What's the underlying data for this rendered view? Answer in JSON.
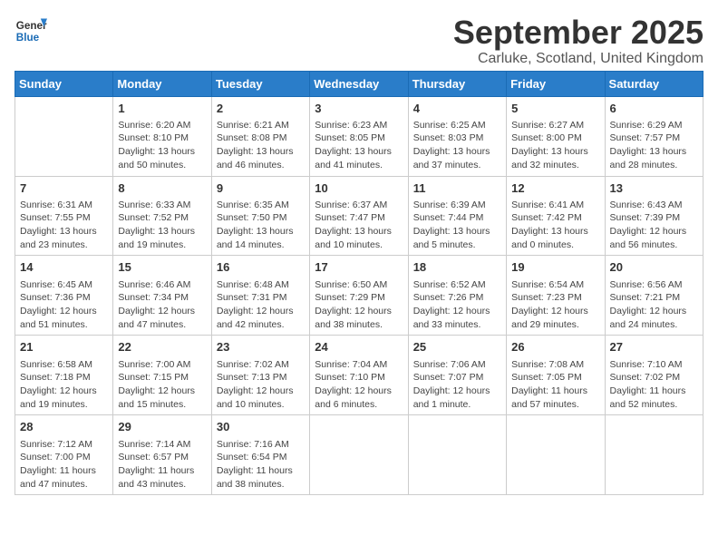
{
  "header": {
    "logo_general": "General",
    "logo_blue": "Blue",
    "month_title": "September 2025",
    "location": "Carluke, Scotland, United Kingdom"
  },
  "days_of_week": [
    "Sunday",
    "Monday",
    "Tuesday",
    "Wednesday",
    "Thursday",
    "Friday",
    "Saturday"
  ],
  "weeks": [
    [
      {
        "day": "",
        "info": ""
      },
      {
        "day": "1",
        "info": "Sunrise: 6:20 AM\nSunset: 8:10 PM\nDaylight: 13 hours\nand 50 minutes."
      },
      {
        "day": "2",
        "info": "Sunrise: 6:21 AM\nSunset: 8:08 PM\nDaylight: 13 hours\nand 46 minutes."
      },
      {
        "day": "3",
        "info": "Sunrise: 6:23 AM\nSunset: 8:05 PM\nDaylight: 13 hours\nand 41 minutes."
      },
      {
        "day": "4",
        "info": "Sunrise: 6:25 AM\nSunset: 8:03 PM\nDaylight: 13 hours\nand 37 minutes."
      },
      {
        "day": "5",
        "info": "Sunrise: 6:27 AM\nSunset: 8:00 PM\nDaylight: 13 hours\nand 32 minutes."
      },
      {
        "day": "6",
        "info": "Sunrise: 6:29 AM\nSunset: 7:57 PM\nDaylight: 13 hours\nand 28 minutes."
      }
    ],
    [
      {
        "day": "7",
        "info": "Sunrise: 6:31 AM\nSunset: 7:55 PM\nDaylight: 13 hours\nand 23 minutes."
      },
      {
        "day": "8",
        "info": "Sunrise: 6:33 AM\nSunset: 7:52 PM\nDaylight: 13 hours\nand 19 minutes."
      },
      {
        "day": "9",
        "info": "Sunrise: 6:35 AM\nSunset: 7:50 PM\nDaylight: 13 hours\nand 14 minutes."
      },
      {
        "day": "10",
        "info": "Sunrise: 6:37 AM\nSunset: 7:47 PM\nDaylight: 13 hours\nand 10 minutes."
      },
      {
        "day": "11",
        "info": "Sunrise: 6:39 AM\nSunset: 7:44 PM\nDaylight: 13 hours\nand 5 minutes."
      },
      {
        "day": "12",
        "info": "Sunrise: 6:41 AM\nSunset: 7:42 PM\nDaylight: 13 hours\nand 0 minutes."
      },
      {
        "day": "13",
        "info": "Sunrise: 6:43 AM\nSunset: 7:39 PM\nDaylight: 12 hours\nand 56 minutes."
      }
    ],
    [
      {
        "day": "14",
        "info": "Sunrise: 6:45 AM\nSunset: 7:36 PM\nDaylight: 12 hours\nand 51 minutes."
      },
      {
        "day": "15",
        "info": "Sunrise: 6:46 AM\nSunset: 7:34 PM\nDaylight: 12 hours\nand 47 minutes."
      },
      {
        "day": "16",
        "info": "Sunrise: 6:48 AM\nSunset: 7:31 PM\nDaylight: 12 hours\nand 42 minutes."
      },
      {
        "day": "17",
        "info": "Sunrise: 6:50 AM\nSunset: 7:29 PM\nDaylight: 12 hours\nand 38 minutes."
      },
      {
        "day": "18",
        "info": "Sunrise: 6:52 AM\nSunset: 7:26 PM\nDaylight: 12 hours\nand 33 minutes."
      },
      {
        "day": "19",
        "info": "Sunrise: 6:54 AM\nSunset: 7:23 PM\nDaylight: 12 hours\nand 29 minutes."
      },
      {
        "day": "20",
        "info": "Sunrise: 6:56 AM\nSunset: 7:21 PM\nDaylight: 12 hours\nand 24 minutes."
      }
    ],
    [
      {
        "day": "21",
        "info": "Sunrise: 6:58 AM\nSunset: 7:18 PM\nDaylight: 12 hours\nand 19 minutes."
      },
      {
        "day": "22",
        "info": "Sunrise: 7:00 AM\nSunset: 7:15 PM\nDaylight: 12 hours\nand 15 minutes."
      },
      {
        "day": "23",
        "info": "Sunrise: 7:02 AM\nSunset: 7:13 PM\nDaylight: 12 hours\nand 10 minutes."
      },
      {
        "day": "24",
        "info": "Sunrise: 7:04 AM\nSunset: 7:10 PM\nDaylight: 12 hours\nand 6 minutes."
      },
      {
        "day": "25",
        "info": "Sunrise: 7:06 AM\nSunset: 7:07 PM\nDaylight: 12 hours\nand 1 minute."
      },
      {
        "day": "26",
        "info": "Sunrise: 7:08 AM\nSunset: 7:05 PM\nDaylight: 11 hours\nand 57 minutes."
      },
      {
        "day": "27",
        "info": "Sunrise: 7:10 AM\nSunset: 7:02 PM\nDaylight: 11 hours\nand 52 minutes."
      }
    ],
    [
      {
        "day": "28",
        "info": "Sunrise: 7:12 AM\nSunset: 7:00 PM\nDaylight: 11 hours\nand 47 minutes."
      },
      {
        "day": "29",
        "info": "Sunrise: 7:14 AM\nSunset: 6:57 PM\nDaylight: 11 hours\nand 43 minutes."
      },
      {
        "day": "30",
        "info": "Sunrise: 7:16 AM\nSunset: 6:54 PM\nDaylight: 11 hours\nand 38 minutes."
      },
      {
        "day": "",
        "info": ""
      },
      {
        "day": "",
        "info": ""
      },
      {
        "day": "",
        "info": ""
      },
      {
        "day": "",
        "info": ""
      }
    ]
  ]
}
